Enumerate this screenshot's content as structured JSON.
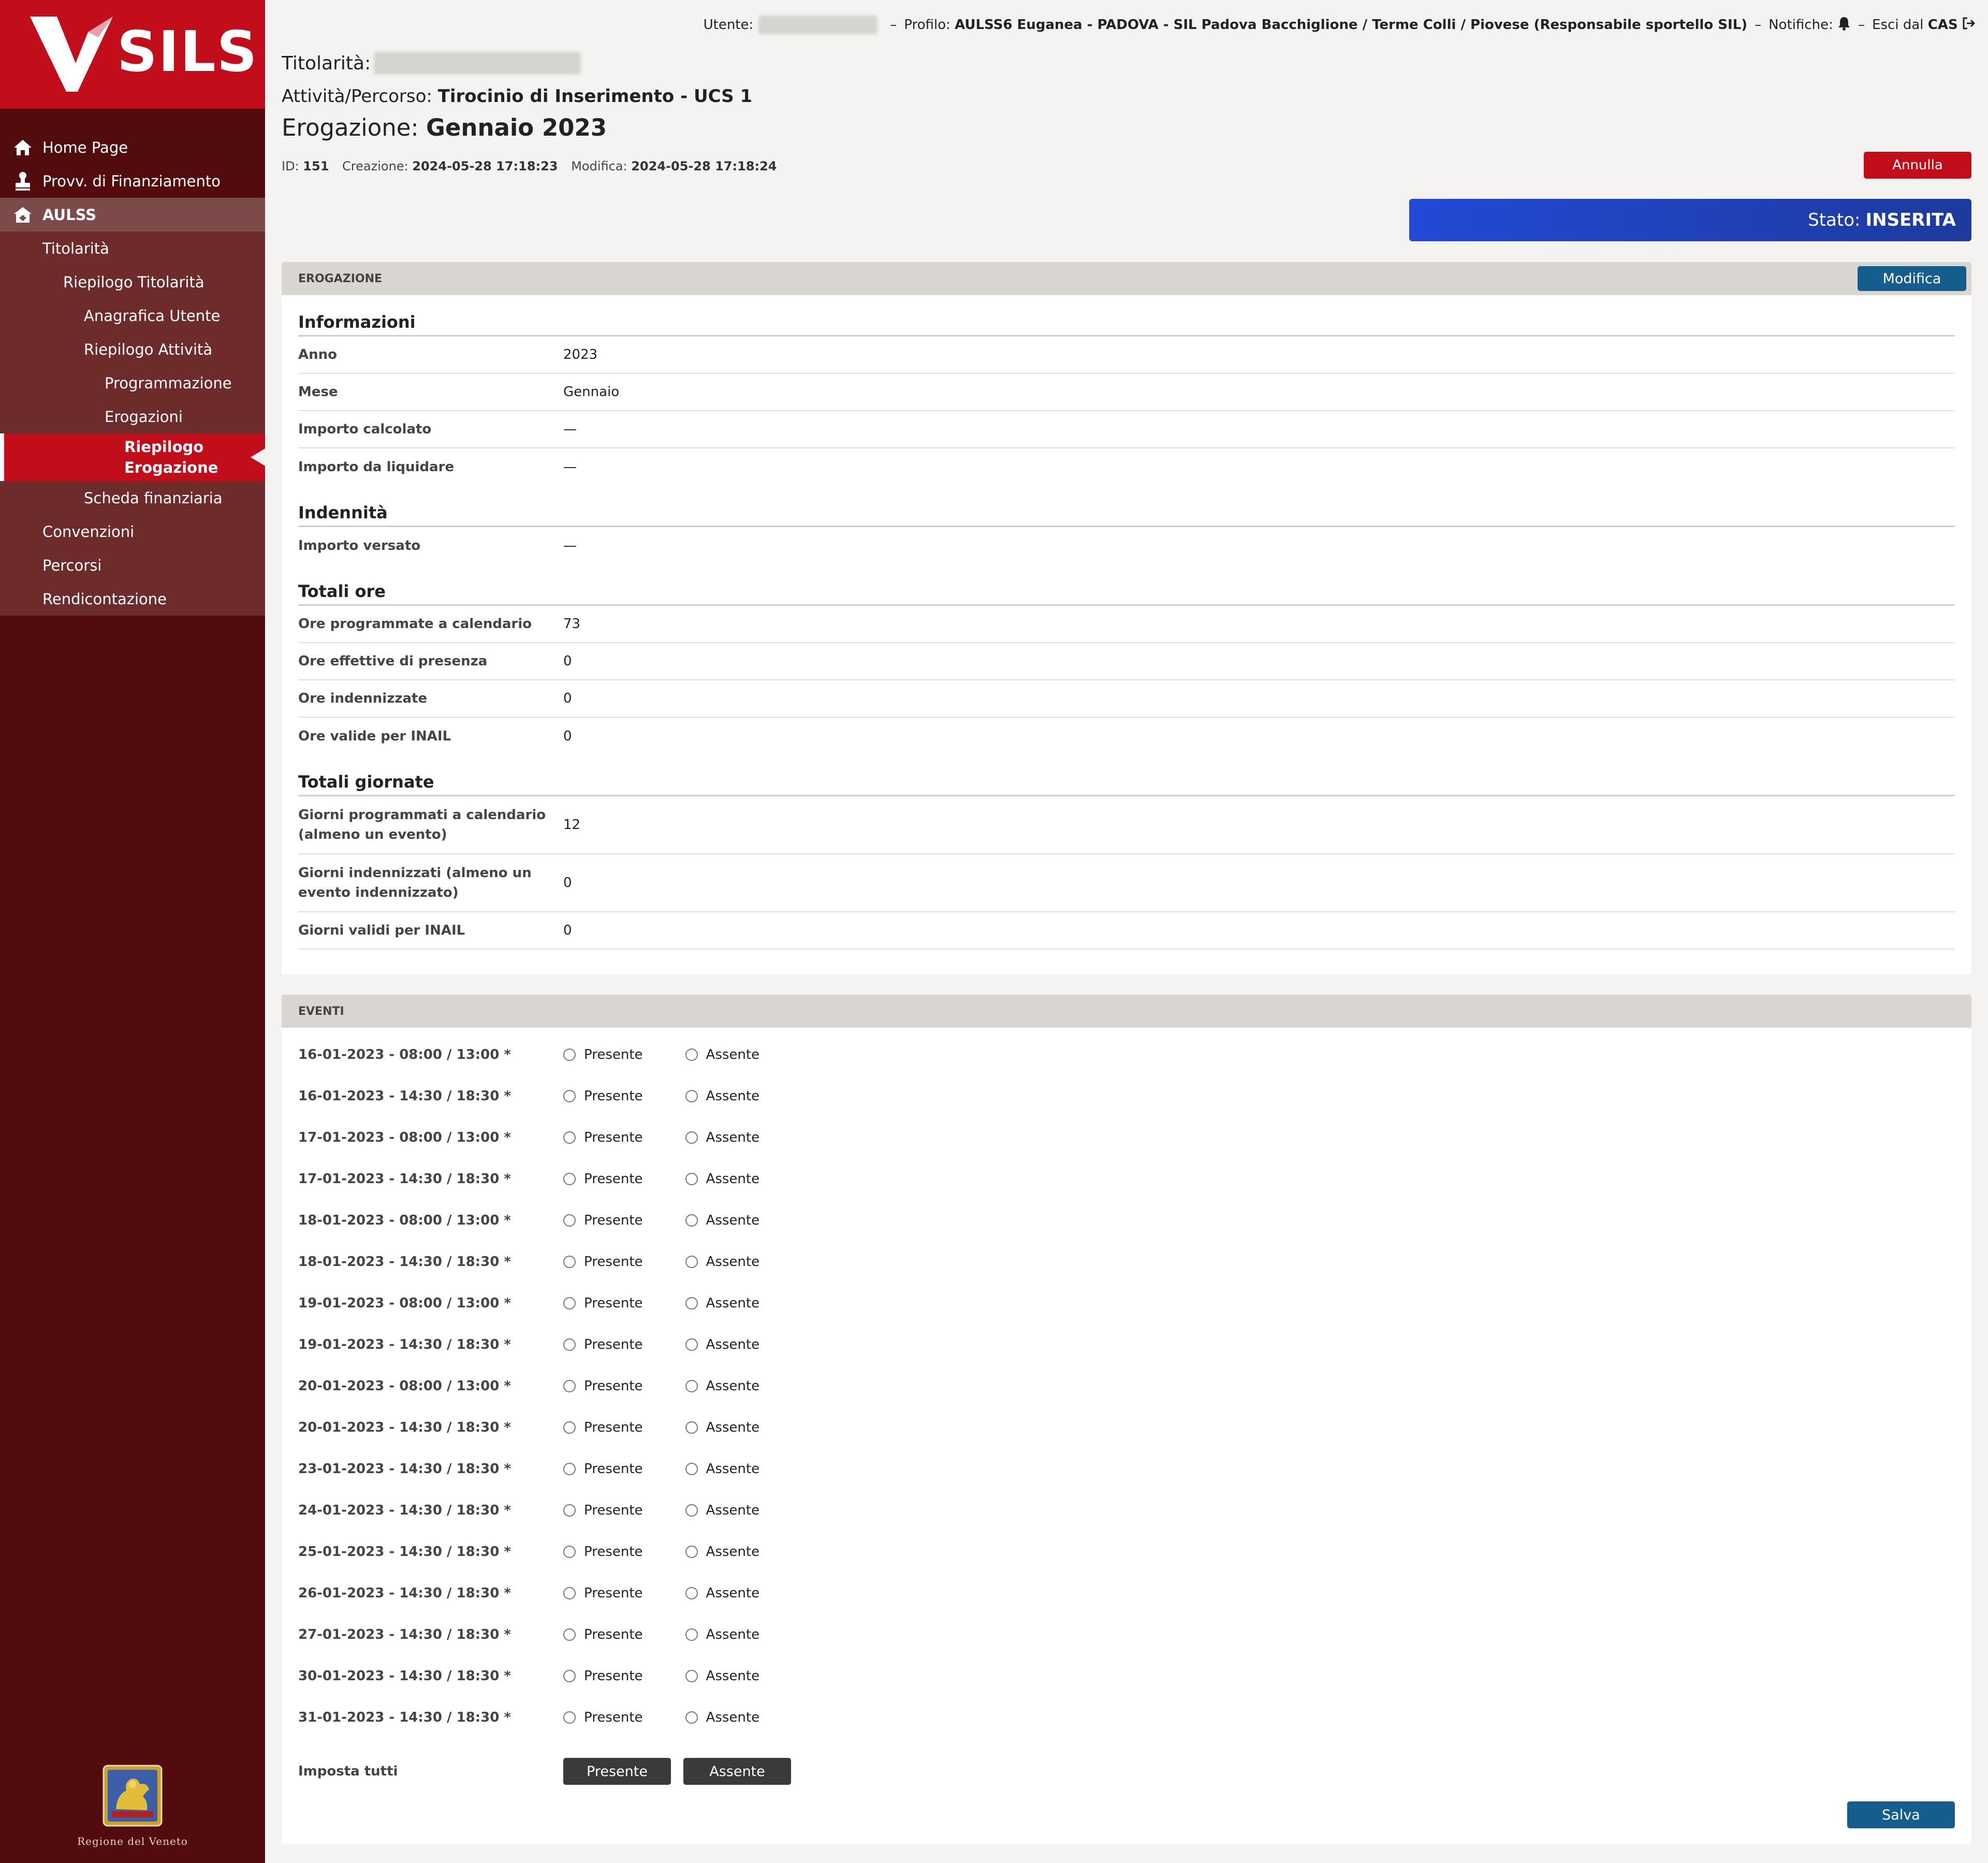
{
  "app": {
    "logo_text": "SILS"
  },
  "sidebar": {
    "items": [
      {
        "label": "Home Page"
      },
      {
        "label": "Provv. di Finanziamento"
      },
      {
        "label": "AULSS"
      },
      {
        "label": "Titolarità"
      },
      {
        "label": "Riepilogo Titolarità"
      },
      {
        "label": "Anagrafica Utente"
      },
      {
        "label": "Riepilogo Attività"
      },
      {
        "label": "Programmazione"
      },
      {
        "label": "Erogazioni"
      },
      {
        "label": "Riepilogo Erogazione"
      },
      {
        "label": "Scheda finanziaria"
      },
      {
        "label": "Convenzioni"
      },
      {
        "label": "Percorsi"
      },
      {
        "label": "Rendicontazione"
      }
    ],
    "footer_label": "Regione del Veneto"
  },
  "topbar": {
    "utente_label": "Utente:",
    "profilo_label": "Profilo:",
    "profilo_value": "AULSS6 Euganea - PADOVA - SIL Padova Bacchiglione / Terme Colli / Piovese (Responsabile sportello SIL)",
    "notifiche_label": "Notifiche:",
    "esci_label": "Esci dal",
    "esci_value": "CAS"
  },
  "header": {
    "titolarita_label": "Titolarità:",
    "attivita_label": "Attività/Percorso:",
    "attivita_value": "Tirocinio di Inserimento - UCS 1",
    "erogazione_label": "Erogazione:",
    "erogazione_value": "Gennaio 2023",
    "id_label": "ID:",
    "id_value": "151",
    "creazione_label": "Creazione:",
    "creazione_value": "2024-05-28 17:18:23",
    "modifica_label": "Modifica:",
    "modifica_value": "2024-05-28 17:18:24",
    "annulla_label": "Annulla",
    "stato_label": "Stato:",
    "stato_value": "INSERITA"
  },
  "erogazione_panel": {
    "title": "EROGAZIONE",
    "modifica_label": "Modifica",
    "sections": {
      "informazioni": {
        "title": "Informazioni",
        "rows": [
          {
            "label": "Anno",
            "value": "2023"
          },
          {
            "label": "Mese",
            "value": "Gennaio"
          },
          {
            "label": "Importo calcolato",
            "value": "—"
          },
          {
            "label": "Importo da liquidare",
            "value": "—"
          }
        ]
      },
      "indennita": {
        "title": "Indennità",
        "rows": [
          {
            "label": "Importo versato",
            "value": "—"
          }
        ]
      },
      "totali_ore": {
        "title": "Totali ore",
        "rows": [
          {
            "label": "Ore programmate a calendario",
            "value": "73"
          },
          {
            "label": "Ore effettive di presenza",
            "value": "0"
          },
          {
            "label": "Ore indennizzate",
            "value": "0"
          },
          {
            "label": "Ore valide per INAIL",
            "value": "0"
          }
        ]
      },
      "totali_giornate": {
        "title": "Totali giornate",
        "rows": [
          {
            "label": "Giorni programmati a calendario (almeno un evento)",
            "value": "12"
          },
          {
            "label": "Giorni indennizzati (almeno un evento indennizzato)",
            "value": "0"
          },
          {
            "label": "Giorni validi per INAIL",
            "value": "0"
          }
        ]
      }
    }
  },
  "eventi_panel": {
    "title": "EVENTI",
    "presente_label": "Presente",
    "assente_label": "Assente",
    "events": [
      "16-01-2023 - 08:00 / 13:00 *",
      "16-01-2023 - 14:30 / 18:30 *",
      "17-01-2023 - 08:00 / 13:00 *",
      "17-01-2023 - 14:30 / 18:30 *",
      "18-01-2023 - 08:00 / 13:00 *",
      "18-01-2023 - 14:30 / 18:30 *",
      "19-01-2023 - 08:00 / 13:00 *",
      "19-01-2023 - 14:30 / 18:30 *",
      "20-01-2023 - 08:00 / 13:00 *",
      "20-01-2023 - 14:30 / 18:30 *",
      "23-01-2023 - 14:30 / 18:30 *",
      "24-01-2023 - 14:30 / 18:30 *",
      "25-01-2023 - 14:30 / 18:30 *",
      "26-01-2023 - 14:30 / 18:30 *",
      "27-01-2023 - 14:30 / 18:30 *",
      "30-01-2023 - 14:30 / 18:30 *",
      "31-01-2023 - 14:30 / 18:30 *"
    ],
    "imposta_label": "Imposta tutti",
    "imposta_presente": "Presente",
    "imposta_assente": "Assente",
    "salva_label": "Salva"
  },
  "colors": {
    "brand_red": "#c20d1a",
    "sidebar_dark": "#520c0e",
    "button_blue": "#155d8c",
    "stato_blue": "#2349d6",
    "dark_button": "#3b3a38"
  },
  "icons": [
    "home-icon",
    "stamp-icon",
    "building-icon",
    "bell-icon",
    "logout-icon",
    "veneto-lion-icon"
  ]
}
